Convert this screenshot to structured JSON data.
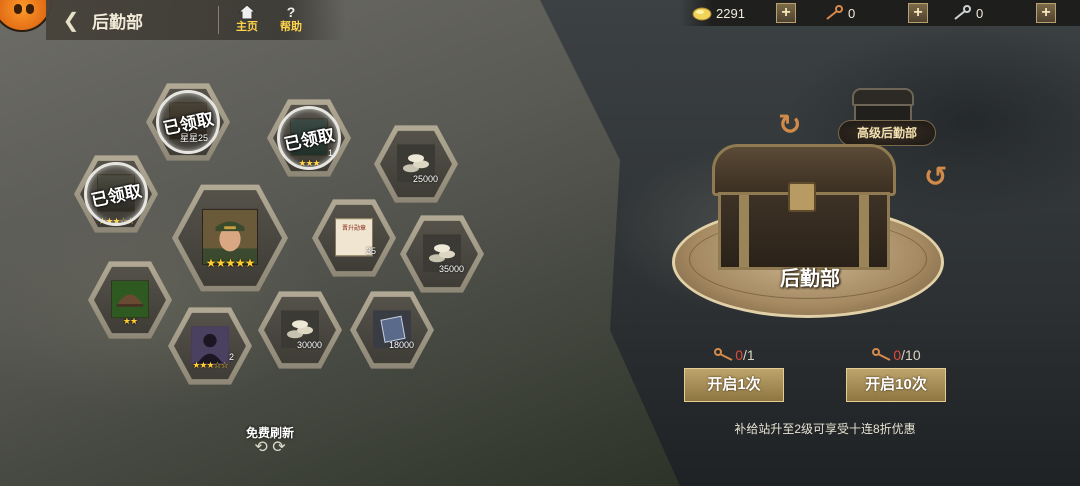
{
  "header": {
    "back_glyph": "❮",
    "title": "后勤部",
    "home_label": "主页",
    "help_label": "帮助",
    "help_glyph": "?"
  },
  "resources": [
    {
      "name": "gold-icon",
      "value": "2291"
    },
    {
      "name": "key-icon",
      "value": "0"
    },
    {
      "name": "advanced-key-icon",
      "value": "0"
    }
  ],
  "plus_glyph": "+",
  "grid": {
    "claimed_label": "已领取",
    "cells": [
      {
        "id": "claimed-star-card",
        "claimed": true,
        "qty": "25",
        "sub": "星星"
      },
      {
        "id": "claimed-badge",
        "claimed": true,
        "stars": "★★★",
        "qty": "1"
      },
      {
        "id": "claimed-avatar",
        "claimed": true,
        "stars": "★★★☆☆"
      },
      {
        "id": "silver-25000",
        "qty": "25000"
      },
      {
        "id": "officer-card",
        "stars": "★★★★★"
      },
      {
        "id": "certificate",
        "qty": "35",
        "doc_title": "晋升勋章"
      },
      {
        "id": "silver-35000",
        "qty": "35000"
      },
      {
        "id": "helmet",
        "stars": "★★"
      },
      {
        "id": "silver-30000",
        "qty": "30000"
      },
      {
        "id": "manual-18000",
        "qty": "18000"
      },
      {
        "id": "soldier-silhouette",
        "stars": "★★★☆☆",
        "qty": "2"
      }
    ]
  },
  "free_refresh": {
    "label": "免费刷新",
    "arrows": "⟲ ⟳"
  },
  "chest": {
    "label": "后勤部",
    "advanced_label": "高级后勤部"
  },
  "open_single": {
    "have": "0",
    "need": "/1",
    "label": "开启1次"
  },
  "open_ten": {
    "have": "0",
    "need": "/10",
    "label": "开启10次"
  },
  "promo_text": "补给站升至2级可享受十连8折优惠",
  "colors": {
    "accent_gold": "#bda46c",
    "key_red": "#e04a3a",
    "star_yellow": "#ffcc33"
  }
}
